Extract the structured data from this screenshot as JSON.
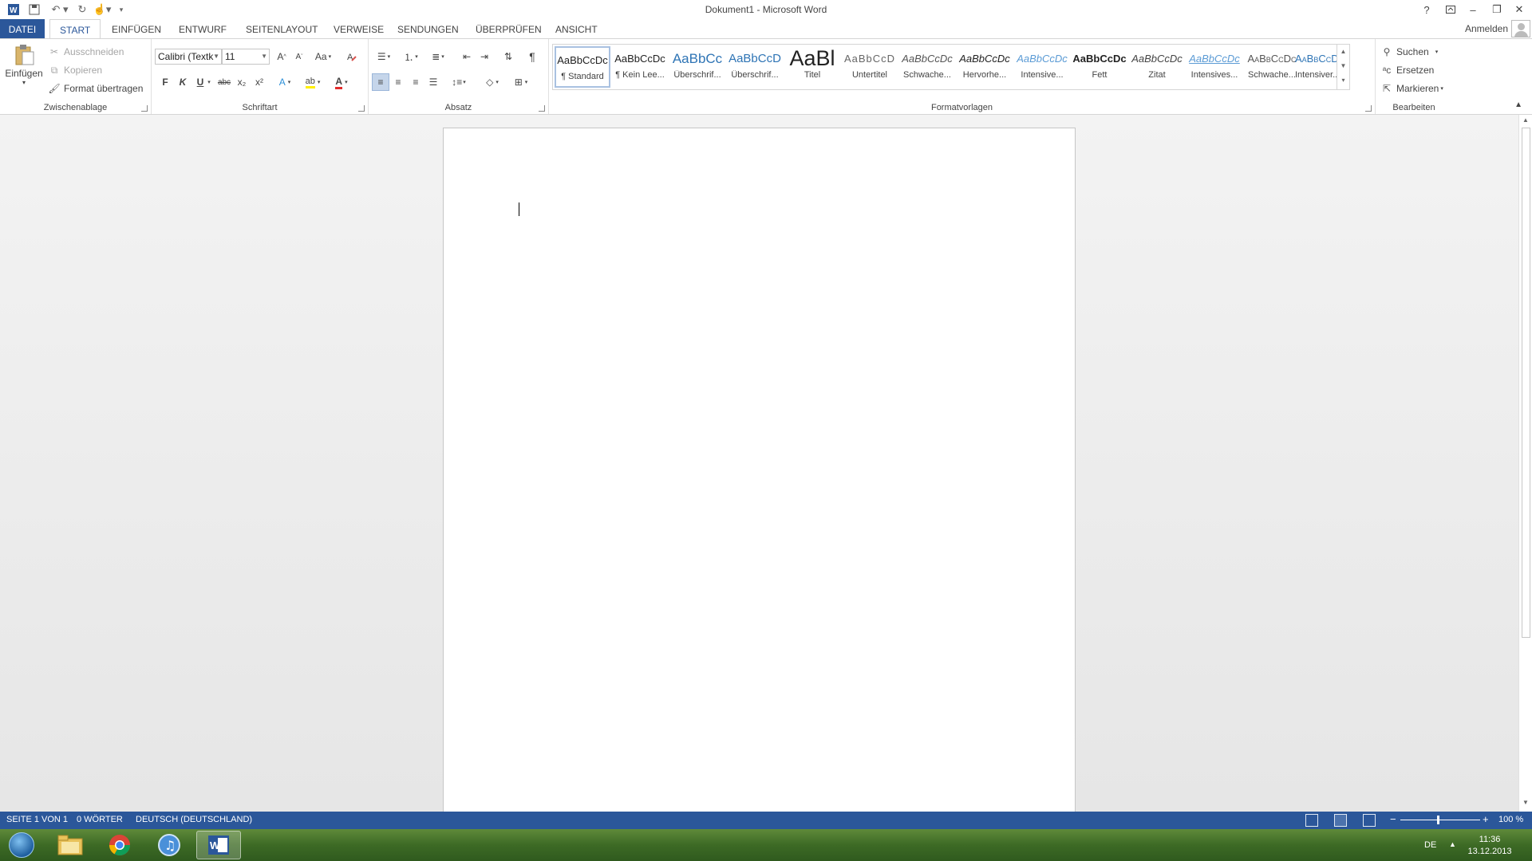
{
  "titlebar": {
    "title": "Dokument1 - Microsoft Word",
    "help": "?",
    "minimize": "–",
    "restore": "❐",
    "close": "✕"
  },
  "tabs": {
    "file": "DATEI",
    "items": [
      "START",
      "EINFÜGEN",
      "ENTWURF",
      "SEITENLAYOUT",
      "VERWEISE",
      "SENDUNGEN",
      "ÜBERPRÜFEN",
      "ANSICHT"
    ],
    "active": "START",
    "signin": "Anmelden"
  },
  "clipboard": {
    "paste": "Einfügen",
    "cut": "Ausschneiden",
    "copy": "Kopieren",
    "format_painter": "Format übertragen",
    "label": "Zwischenablage"
  },
  "font": {
    "family": "Calibri (Textk",
    "size": "11",
    "grow": "A",
    "shrink": "A",
    "case": "Aa",
    "bold": "F",
    "italic": "K",
    "underline": "U",
    "strike": "abc",
    "subscript": "x₂",
    "superscript": "x²",
    "effects": "A",
    "highlight": "ab",
    "color": "A",
    "label": "Schriftart"
  },
  "paragraph": {
    "label": "Absatz",
    "pilcrow": "¶"
  },
  "styles": {
    "label": "Formatvorlagen",
    "items": [
      {
        "preview": "AaBbCcDc",
        "name": "¶ Standard"
      },
      {
        "preview": "AaBbCcDc",
        "name": "¶ Kein Lee..."
      },
      {
        "preview": "AaBbCc",
        "name": "Überschrif..."
      },
      {
        "preview": "AaBbCcD",
        "name": "Überschrif..."
      },
      {
        "preview": "AaBl",
        "name": "Titel"
      },
      {
        "preview": "AaBbCcD",
        "name": "Untertitel"
      },
      {
        "preview": "AaBbCcDc",
        "name": "Schwache..."
      },
      {
        "preview": "AaBbCcDc",
        "name": "Hervorhe..."
      },
      {
        "preview": "AaBbCcDc",
        "name": "Intensive..."
      },
      {
        "preview": "AaBbCcDc",
        "name": "Fett"
      },
      {
        "preview": "AaBbCcDc",
        "name": "Zitat"
      },
      {
        "preview": "AaBbCcDc",
        "name": "Intensives..."
      },
      {
        "preview": "AaBbCcDc",
        "name": "Schwache..."
      },
      {
        "preview": "AaBbCcDc",
        "name": "Intensiver..."
      }
    ]
  },
  "editing": {
    "label": "Bearbeiten",
    "find": "Suchen",
    "replace": "Ersetzen",
    "select": "Markieren"
  },
  "status": {
    "page": "SEITE 1 VON 1",
    "words": "0 WÖRTER",
    "language": "DEUTSCH (DEUTSCHLAND)",
    "zoom": "100 %",
    "zoom_out": "−",
    "zoom_in": "+"
  },
  "taskbar": {
    "lang": "DE",
    "time": "11:36",
    "date": "13.12.2013"
  },
  "colors": {
    "accent": "#2b579a",
    "taskbar": "#3d6a25"
  }
}
